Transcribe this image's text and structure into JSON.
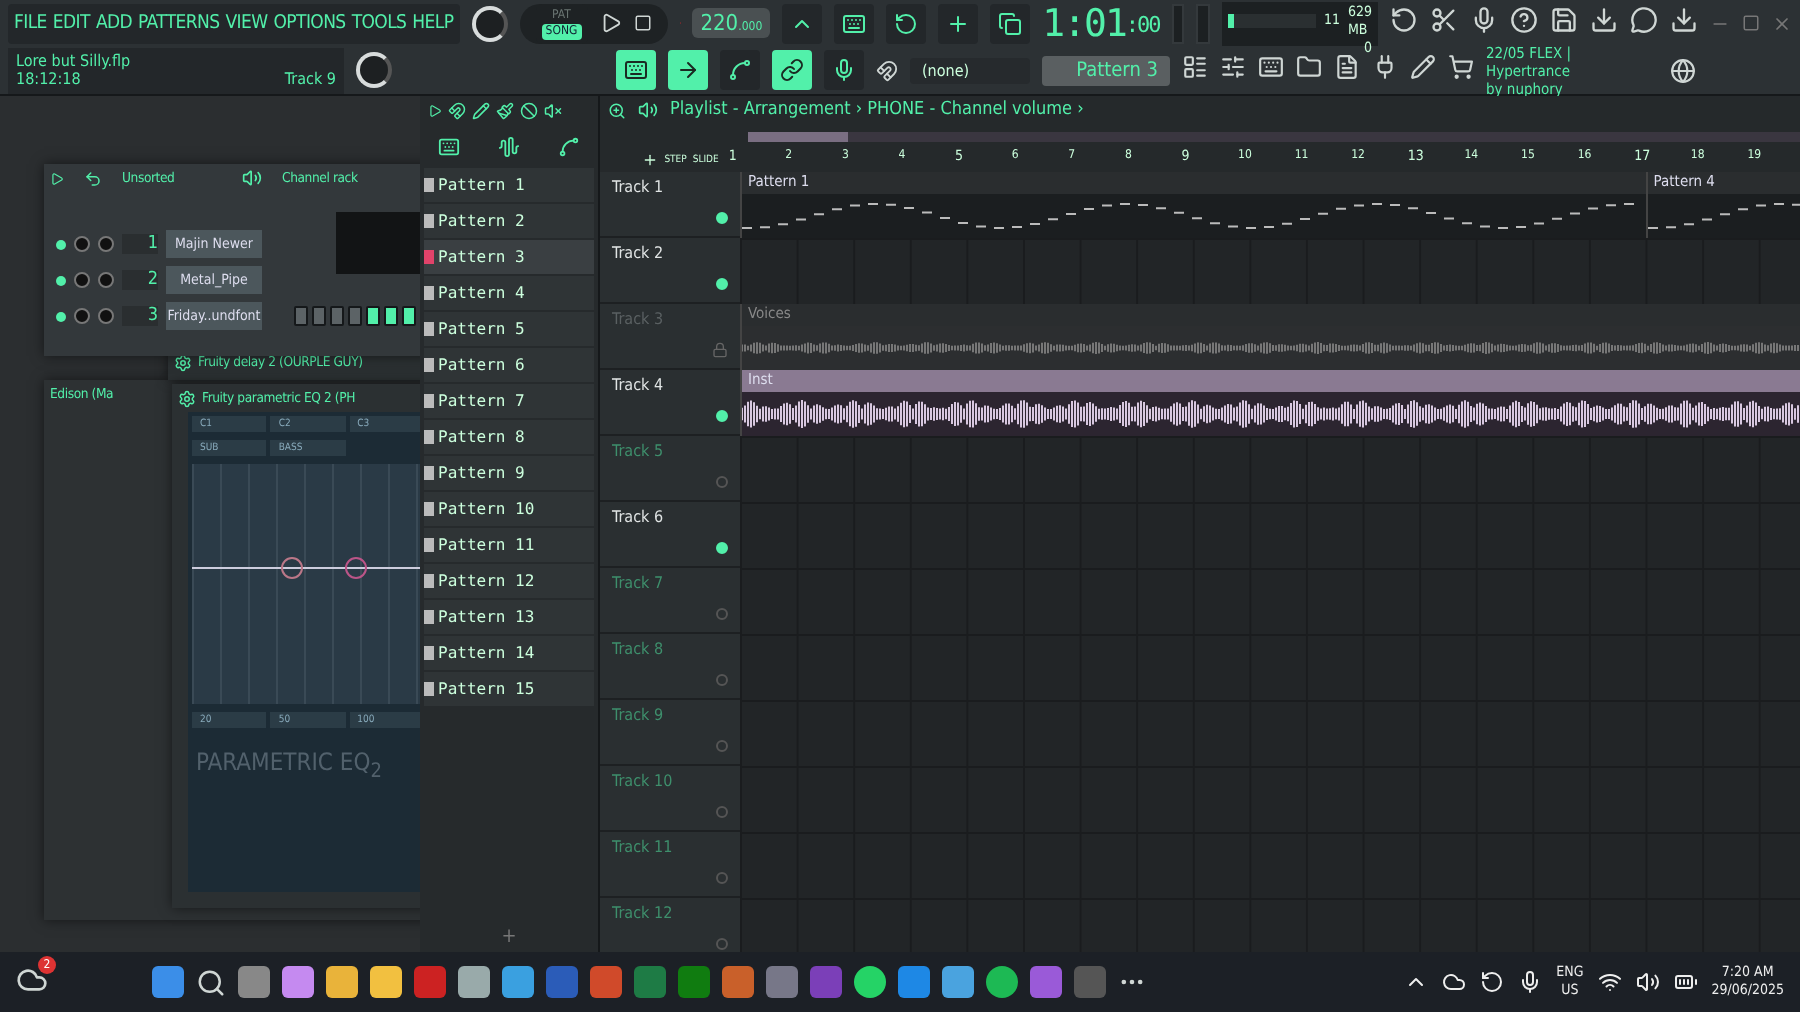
{
  "menu": [
    "FILE",
    "EDIT",
    "ADD",
    "PATTERNS",
    "VIEW",
    "OPTIONS",
    "TOOLS",
    "HELP"
  ],
  "transport": {
    "modes": [
      {
        "label": "PAT",
        "selected": false
      },
      {
        "label": "SONG",
        "selected": true
      }
    ],
    "tempo": "220",
    "tempo_fraction": ".000",
    "time": "1:01",
    "time_ticks": ":00"
  },
  "monitor": {
    "voices": "11",
    "memory": "629 MB",
    "cpu": "0",
    "level": 0.08
  },
  "project": {
    "file": "Lore but Silly.flp",
    "time": "18:12:18",
    "track": "Track 9"
  },
  "snap": "(none)",
  "pattern": "Pattern 3",
  "news": {
    "date": "22/05",
    "title": "FLEX | Hypertrance",
    "author": "by nuphory"
  },
  "channel_rack": {
    "filter": "Unsorted",
    "title": "Channel rack",
    "channels": [
      {
        "number": "1",
        "name": "Majin Newer"
      },
      {
        "number": "2",
        "name": "Metal_Pipe"
      },
      {
        "number": "3",
        "name": "Friday..undfont",
        "steps": [
          false,
          false,
          false,
          false,
          true,
          true,
          true
        ]
      }
    ]
  },
  "plugins": {
    "delay": "Fruity delay 2 (OURPLE GUY)",
    "eq": "Fruity parametric EQ 2 (PH",
    "edison": "Edison (Ma",
    "eq_bands": [
      "C1",
      "C2",
      "C3"
    ],
    "eq_groups": [
      "SUB",
      "BASS"
    ],
    "eq_freqs": [
      "20",
      "50",
      "100"
    ],
    "eq_logo": "PARAMETRIC EQ$_{2}$"
  },
  "picker": {
    "patterns": [
      {
        "label": "Pattern 1",
        "selected": false
      },
      {
        "label": "Pattern 2",
        "selected": false
      },
      {
        "label": "Pattern 3",
        "selected": true
      },
      {
        "label": "Pattern 4",
        "selected": false
      },
      {
        "label": "Pattern 5",
        "selected": false
      },
      {
        "label": "Pattern 6",
        "selected": false
      },
      {
        "label": "Pattern 7",
        "selected": false
      },
      {
        "label": "Pattern 8",
        "selected": false
      },
      {
        "label": "Pattern 9",
        "selected": false
      },
      {
        "label": "Pattern 10",
        "selected": false
      },
      {
        "label": "Pattern 11",
        "selected": false
      },
      {
        "label": "Pattern 12",
        "selected": false
      },
      {
        "label": "Pattern 13",
        "selected": false
      },
      {
        "label": "Pattern 14",
        "selected": false
      },
      {
        "label": "Pattern 15",
        "selected": false
      }
    ],
    "add": "+"
  },
  "playlist": {
    "title": "Playlist - Arrangement › PHONE - Channel volume ›",
    "step_label": "STEP",
    "slide_label": "SLIDE",
    "bars": [
      "1",
      "2",
      "3",
      "4",
      "5",
      "6",
      "7",
      "8",
      "9",
      "10",
      "11",
      "12",
      "13",
      "14",
      "15",
      "16",
      "17",
      "18",
      "19"
    ],
    "tracks": [
      {
        "name": "Track 1",
        "highlighted": true,
        "muted": false
      },
      {
        "name": "Track 2",
        "highlighted": true,
        "muted": false
      },
      {
        "name": "Track 3",
        "highlighted": false,
        "muted": true
      },
      {
        "name": "Track 4",
        "highlighted": true,
        "muted": false
      },
      {
        "name": "Track 5",
        "highlighted": false,
        "muted": false
      },
      {
        "name": "Track 6",
        "highlighted": true,
        "muted": false
      },
      {
        "name": "Track 7",
        "highlighted": false,
        "muted": false
      },
      {
        "name": "Track 8",
        "highlighted": false,
        "muted": false
      },
      {
        "name": "Track 9",
        "highlighted": false,
        "muted": false
      },
      {
        "name": "Track 10",
        "highlighted": false,
        "muted": false
      },
      {
        "name": "Track 11",
        "highlighted": false,
        "muted": false
      },
      {
        "name": "Track 12",
        "highlighted": false,
        "muted": false
      }
    ],
    "clips": [
      {
        "kind": "pattern",
        "label": "Pattern 1",
        "muted": false
      },
      {
        "kind": "pattern",
        "label": "Pattern 4",
        "muted": false
      },
      {
        "kind": "audio",
        "label": "Voices",
        "muted": true
      },
      {
        "kind": "audio",
        "label": "Inst",
        "muted": false
      }
    ]
  },
  "taskbar": {
    "weather_badge": "2",
    "language": "ENG",
    "region": "US",
    "time": "7:20 AM",
    "date": "29/06/2025"
  }
}
